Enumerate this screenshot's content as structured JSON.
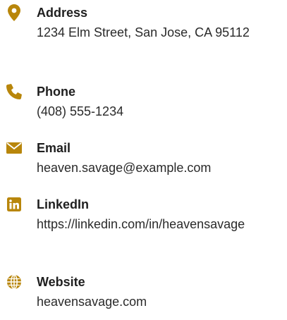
{
  "accent_color": "#b8860b",
  "contacts": {
    "address": {
      "icon": "map-marker-icon",
      "label": "Address",
      "value": "1234 Elm Street, San Jose, CA 95112"
    },
    "phone": {
      "icon": "phone-icon",
      "label": "Phone",
      "value": "(408) 555-1234"
    },
    "email": {
      "icon": "envelope-icon",
      "label": "Email",
      "value": "heaven.savage@example.com"
    },
    "linkedin": {
      "icon": "linkedin-icon",
      "label": "LinkedIn",
      "value": "https://linkedin.com/in/heavensavage"
    },
    "website": {
      "icon": "globe-icon",
      "label": "Website",
      "value": "heavensavage.com"
    }
  }
}
